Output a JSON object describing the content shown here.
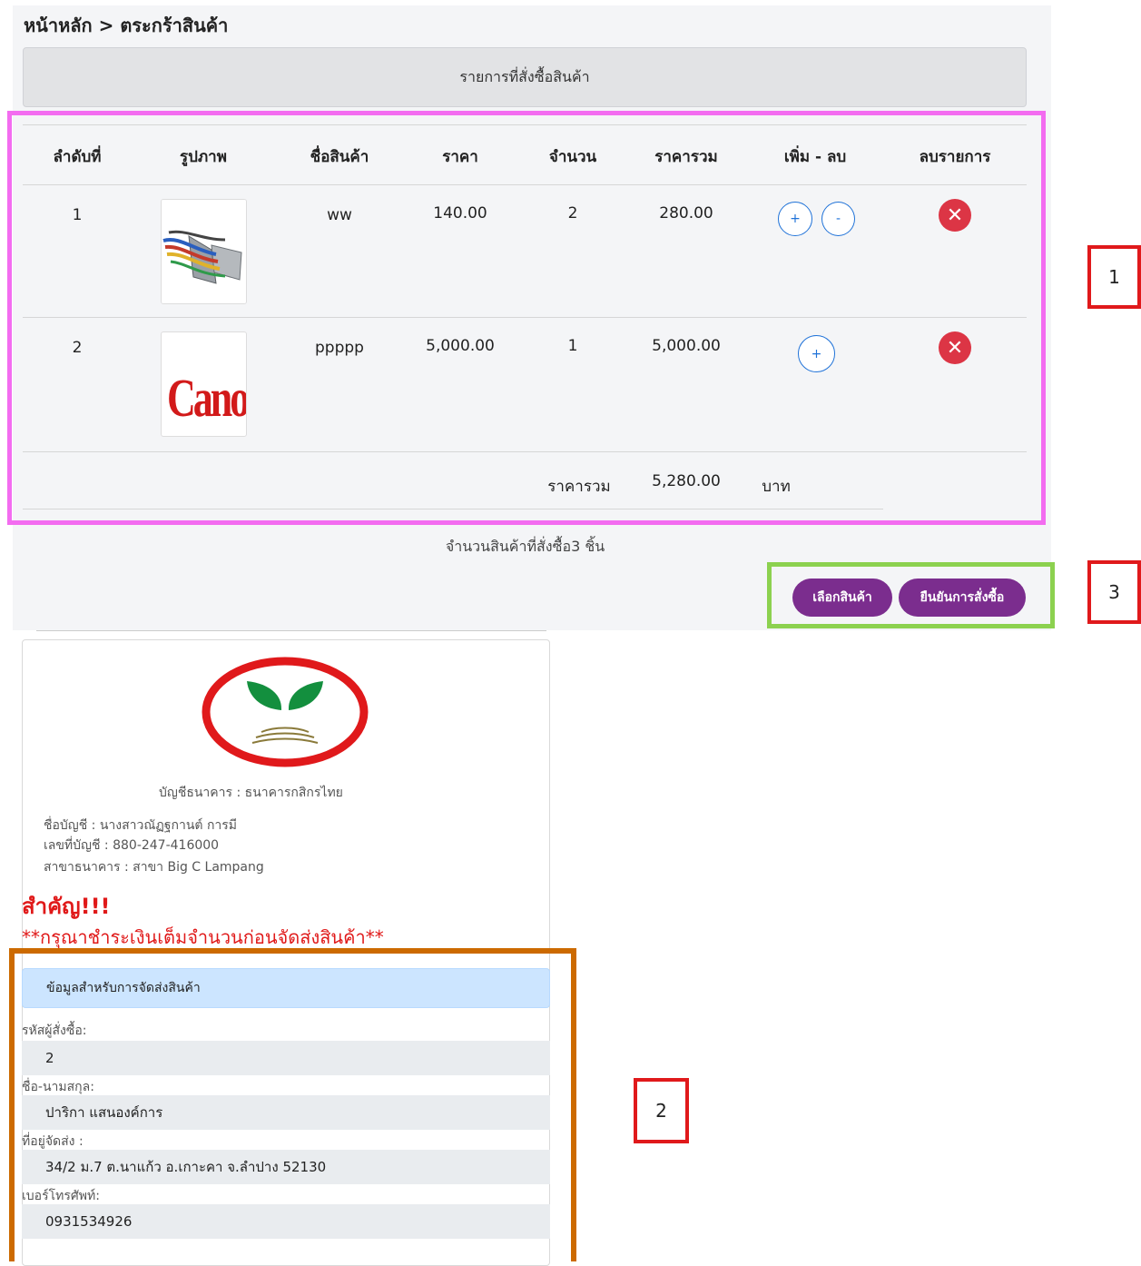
{
  "breadcrumb": "หน้าหลัก > ตระกร้าสินค้า",
  "order_header": "รายการที่สั่งซื้อสินค้า",
  "table": {
    "headers": [
      "ลำดับที่",
      "รูปภาพ",
      "ชื่อสินค้า",
      "ราคา",
      "จำนวน",
      "ราคารวม",
      "เพิ่ม - ลบ",
      "ลบรายการ"
    ],
    "rows": [
      {
        "no": "1",
        "name": "ww",
        "price": "140.00",
        "qty": "2",
        "total": "280.00",
        "plus": "+",
        "minus": "-"
      },
      {
        "no": "2",
        "name": "ppppp",
        "price": "5,000.00",
        "qty": "1",
        "total": "5,000.00",
        "plus": "+"
      }
    ],
    "image2_text": "Canon",
    "sum_label": "ราคารวม",
    "sum_value": "5,280.00",
    "currency": "บาท"
  },
  "item_count": "จำนวนสินค้าที่สั่งซื้อ3 ชิ้น",
  "buttons": {
    "choose": "เลือกสินค้า",
    "confirm": "ยืนยันการสั่งซื้อ"
  },
  "annotations": [
    "1",
    "2",
    "3"
  ],
  "bank": {
    "bank_name": "บัญชีธนาคาร : ธนาคารกสิกรไทย",
    "account_name": "ชื่อบัญชี : นางสาวณัฏฐกานต์ การมี",
    "account_no": "เลขที่บัญชี : 880-247-416000",
    "branch": "สาขาธนาคาร : สาขา Big C Lampang",
    "important": "สำคัญ!!!",
    "note": "**กรุณาชำระเงินเต็มจำนวนก่อนจัดส่งสินค้า**"
  },
  "shipping": {
    "header": "ข้อมูลสำหรับการจัดส่งสินค้า",
    "fields": [
      {
        "label": "รหัสผู้สั่งซื้อ:",
        "value": "2"
      },
      {
        "label": "ชื่อ-นามสกุล:",
        "value": "ปาริกา แสนองค์การ"
      },
      {
        "label": "ที่อยู่จัดส่ง :",
        "value": "34/2 ม.7 ต.นาแก้ว อ.เกาะคา จ.ลำปาง 52130"
      },
      {
        "label": "เบอร์โทรศัพท์:",
        "value": "0931534926"
      }
    ]
  },
  "colors": {
    "accent_purple": "#7b2d8e",
    "delete_red": "#dc3545",
    "link_blue": "#1f72d8",
    "annotation_pink": "#f36cf0",
    "annotation_green": "#8cd14f",
    "annotation_orange": "#cc6a00",
    "annotation_red": "#e0191b",
    "kbank_green": "#138f3e"
  }
}
